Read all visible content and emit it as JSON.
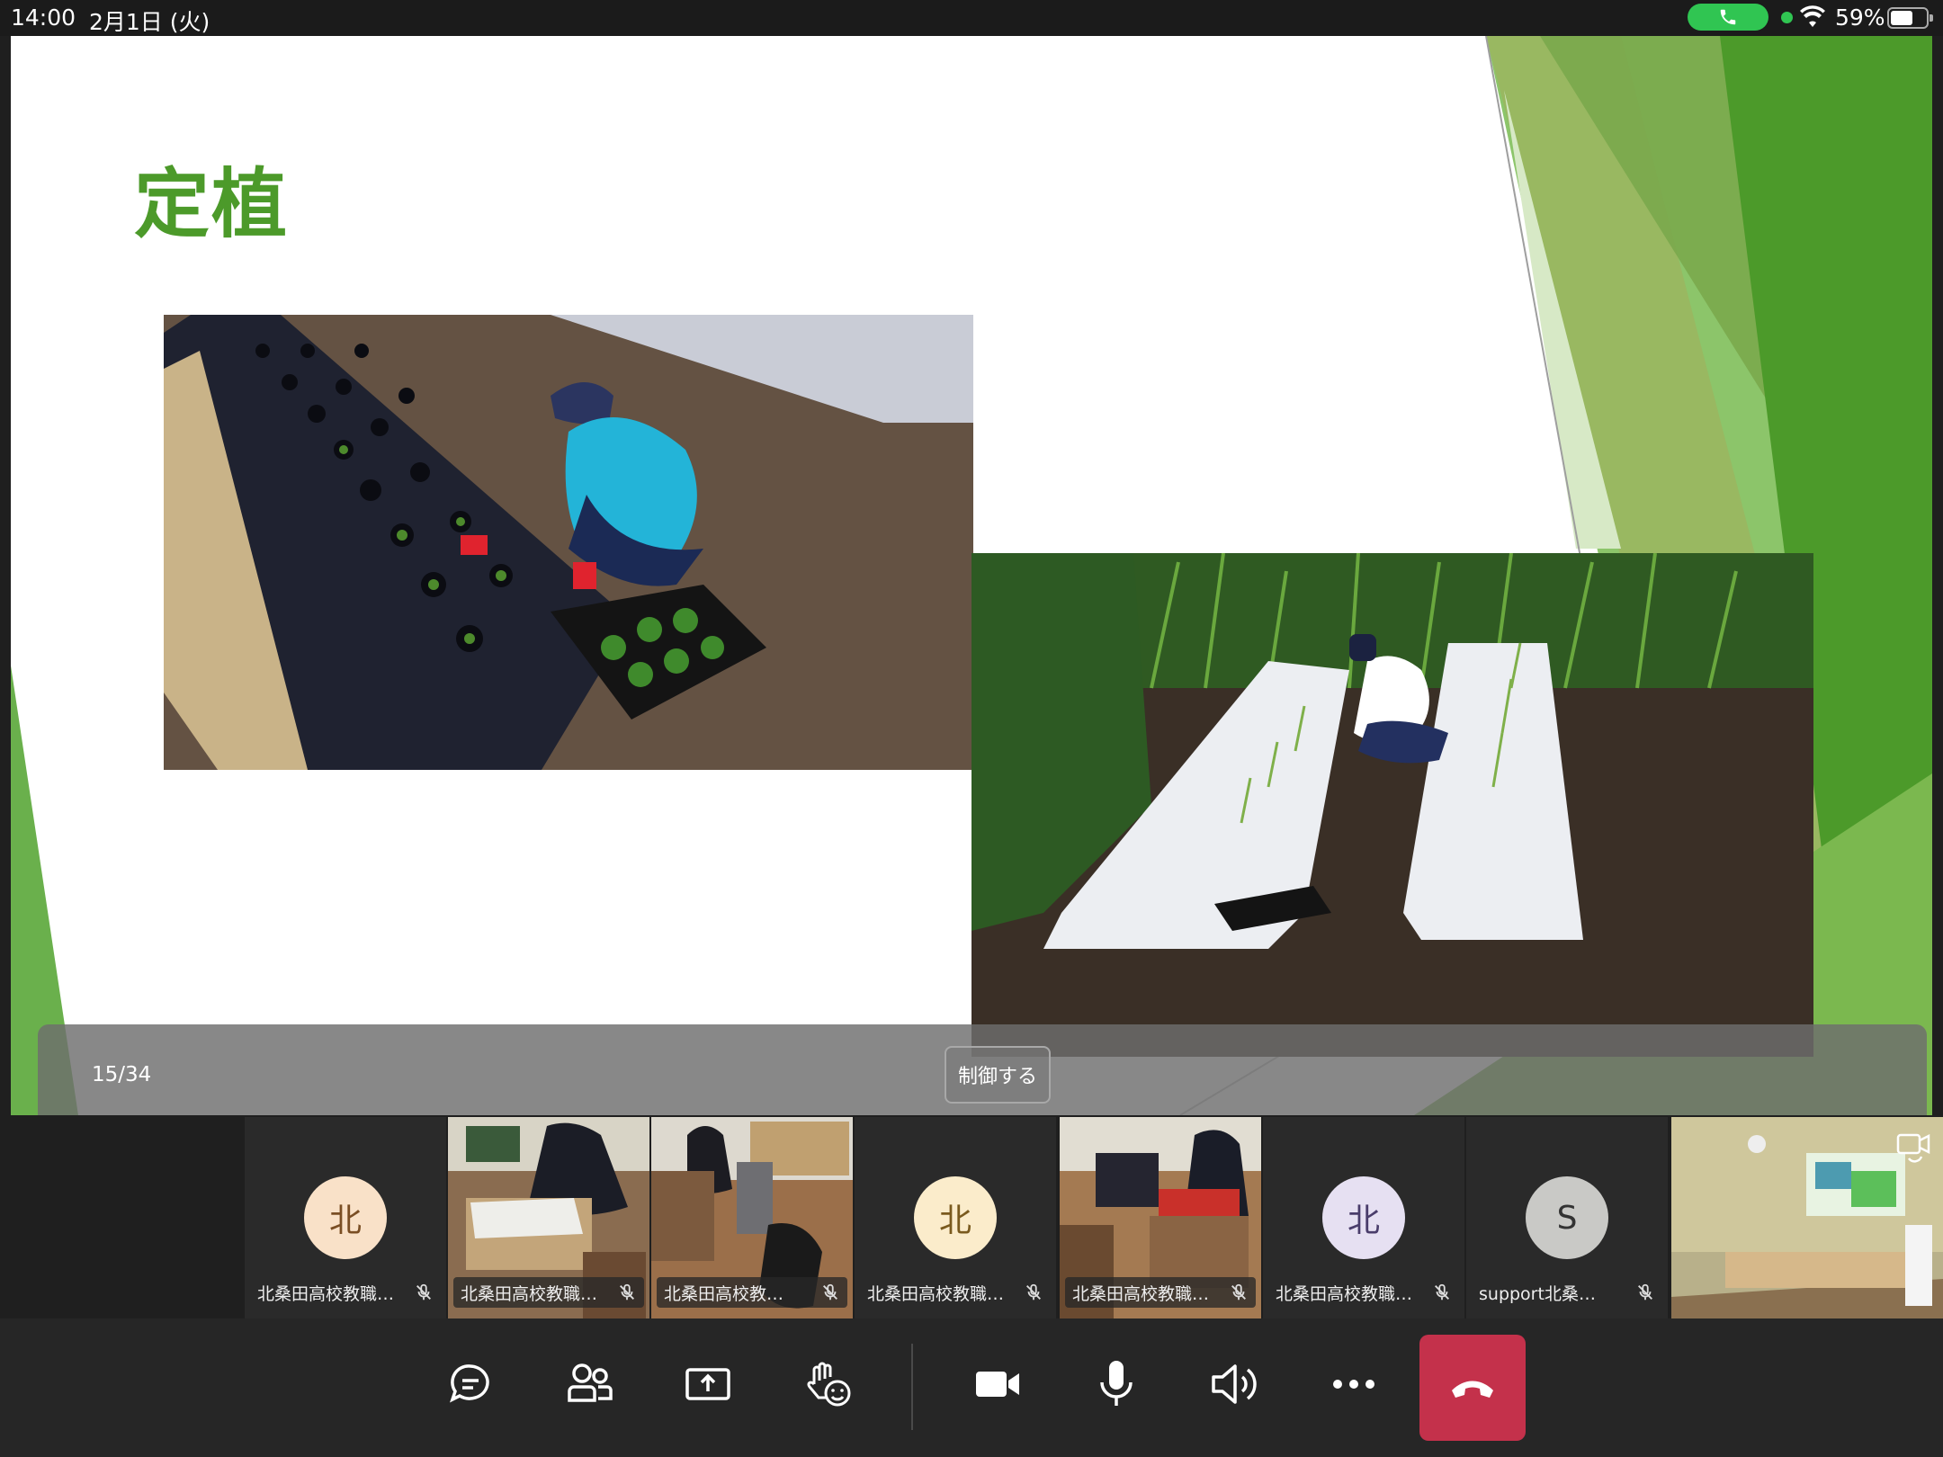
{
  "status_bar": {
    "time": "14:00",
    "date": "2月1日 (火)",
    "battery": "59%",
    "call_indicator_color": "#30c552"
  },
  "slide": {
    "title": "定植",
    "title_color": "#4c9a2a",
    "photos": [
      "planting-seedlings-photo-1",
      "planting-seedlings-photo-2"
    ],
    "counter": "15/34",
    "control_label": "制御する"
  },
  "participants": [
    {
      "name": "北桑田高校教職…",
      "avatar": "北",
      "avatar_bg": "#f9e1c8",
      "avatar_fg": "#7a4e24",
      "type": "avatar"
    },
    {
      "name": "北桑田高校教職…",
      "type": "video"
    },
    {
      "name": "北桑田高校教…",
      "type": "video"
    },
    {
      "name": "北桑田高校教職…",
      "avatar": "北",
      "avatar_bg": "#fbeccb",
      "avatar_fg": "#7a5a1e",
      "type": "avatar"
    },
    {
      "name": "北桑田高校教職…",
      "type": "video"
    },
    {
      "name": "北桑田高校教職…",
      "avatar": "北",
      "avatar_bg": "#e6e0f2",
      "avatar_fg": "#4a3d6b",
      "type": "avatar"
    },
    {
      "name": "support北桑…",
      "avatar": "S",
      "avatar_bg": "#c9c9c6",
      "avatar_fg": "#333333",
      "type": "avatar"
    },
    {
      "name": "",
      "type": "self-video"
    }
  ],
  "toolbar": {
    "icons": [
      "chat-icon",
      "people-icon",
      "share-icon",
      "raise-hand-icon",
      "camera-icon",
      "microphone-icon",
      "speaker-icon",
      "more-icon",
      "hang-up-icon"
    ],
    "hangup_color": "#c4314b"
  }
}
